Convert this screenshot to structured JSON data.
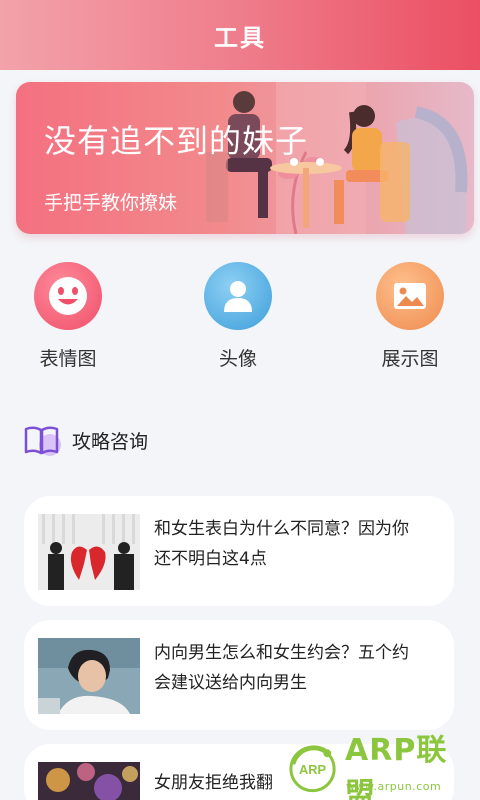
{
  "header": {
    "title": "工具"
  },
  "banner": {
    "title": "没有追不到的妹子",
    "subtitle": "手把手教你撩妹"
  },
  "quick_actions": [
    {
      "label": "表情图",
      "icon": "smiley-icon",
      "color": "#f05a73"
    },
    {
      "label": "头像",
      "icon": "user-icon",
      "color": "#4aa8e0"
    },
    {
      "label": "展示图",
      "icon": "picture-icon",
      "color": "#f0955a"
    }
  ],
  "section": {
    "title": "攻略咨询",
    "icon": "book-icon"
  },
  "articles": [
    {
      "title": "和女生表白为什么不同意？因为你还不明白这4点",
      "thumb": "broken-heart-couple-photo"
    },
    {
      "title": "内向男生怎么和女生约会？五个约会建议送给内向男生",
      "thumb": "young-man-photo"
    },
    {
      "title": "女朋友拒绝我翻",
      "thumb": "bokeh-lights-photo"
    }
  ],
  "watermark": {
    "logo_text": "ARP联盟",
    "badge": "ARP",
    "url": "www.arpun.com"
  }
}
